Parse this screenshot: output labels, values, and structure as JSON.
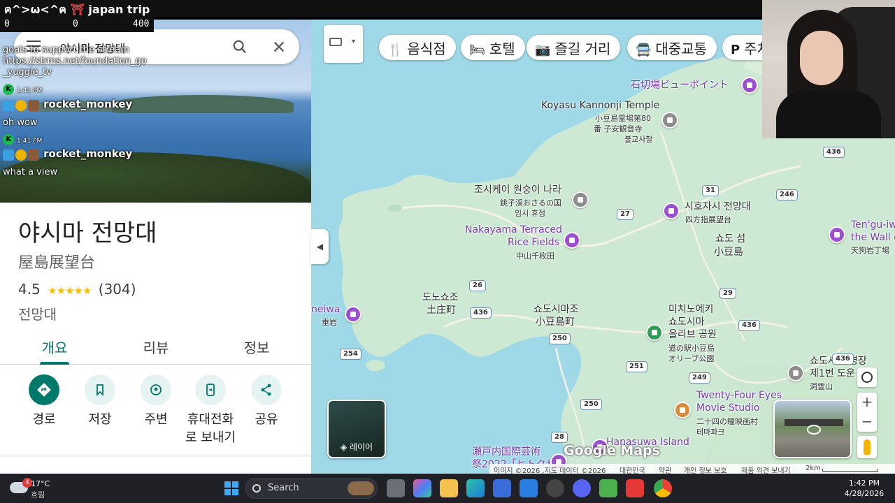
{
  "stream": {
    "title_prefix": "ฅ^>ω<^ฅ",
    "title_icon": "⛩",
    "title_text": "japan trip",
    "counter": [
      "0",
      "0",
      "400"
    ]
  },
  "chat": {
    "line1": "goals to support the stream",
    "line2": "https://strms.net/foundation_go",
    "line3": "_yuggie_tv",
    "messages": [
      {
        "time": "1:41 PM",
        "user": "rocket_monkey",
        "text": "oh wow"
      },
      {
        "time": "1:41 PM",
        "user": "rocket_monkey",
        "text": "what a view"
      }
    ]
  },
  "search": {
    "query": "야시마 전망대"
  },
  "place": {
    "name": "야시마 전망대",
    "subtitle": "屋島展望台",
    "rating": "4.5",
    "stars": "★★★★★",
    "reviews": "(304)",
    "category": "전망대"
  },
  "tabs": [
    {
      "label": "개요"
    },
    {
      "label": "리뷰"
    },
    {
      "label": "정보"
    }
  ],
  "actions": [
    {
      "label": "경로",
      "icon": "directions-icon"
    },
    {
      "label": "저장",
      "icon": "bookmark-icon"
    },
    {
      "label": "주변",
      "icon": "nearby-icon"
    },
    {
      "label": "휴대전화\n로 보내기",
      "label_l1": "휴대전화",
      "label_l2": "로 보내기",
      "icon": "send-to-phone-icon"
    },
    {
      "label": "공유",
      "icon": "share-icon"
    }
  ],
  "map": {
    "chips": [
      {
        "icon": "utensils-icon",
        "glyph": "🍴",
        "label": "음식점"
      },
      {
        "icon": "bed-icon",
        "glyph": "🛏",
        "label": "호텔"
      },
      {
        "icon": "camera-icon",
        "glyph": "📷",
        "label": "즐길 거리"
      },
      {
        "icon": "transit-icon",
        "glyph": "🚍",
        "label": "대중교통"
      },
      {
        "icon": "parking-icon",
        "glyph": "P",
        "label": "주차"
      }
    ],
    "labels": {
      "ishikiriba": "石切場ビューポイント",
      "koyasu_en": "Koyasu Kannonji Temple",
      "koyasu_jp1": "小豆島霊場第80",
      "koyasu_jp2": "番 子安観音寺",
      "koyasu_jp3": "불교사찰",
      "choshikei_ko": "조시케이 원숭이 나라",
      "choshikei_jp": "銚子渓おさるの国",
      "choshikei_status": "임시 휴점",
      "nakayama_1": "Nakayama Terraced",
      "nakayama_2": "Rice Fields",
      "nakayama_jp": "中山千枚田",
      "shihozashi_ko": "시호자시 전망대",
      "shihozashi_jp": "四方指展望台",
      "shodoshima_ko": "쇼도 섬",
      "shodoshima_jp": "小豆島",
      "tengu_1": "Ten'gu-iw",
      "tengu_2": "the Wall o",
      "tengu_3": "天狗岩丁場",
      "tonosho_ko": "도노쇼조",
      "tonosho_jp": "土庄町",
      "shodoshimacho_ko": "쇼도시마조",
      "shodoshimacho_jp": "小豆島町",
      "neiwa": "neiwa",
      "neiwa_jp": "重岩",
      "michinoeki_1": "미치노에키",
      "michinoeki_2": "쇼도시마",
      "michinoeki_3": "올리브 공원",
      "michinoeki_4": "道の駅小豆島",
      "michinoeki_5": "オリーブ公園",
      "dounzan_1": "쇼도시마 영장",
      "dounzan_2": "제1번 도운",
      "dounzan_3": "洞雲山",
      "twentyfour_1": "Twenty-Four Eyes",
      "twentyfour_2": "Movie Studio",
      "twentyfour_3": "二十四の瞳映画村",
      "twentyfour_4": "테마파크",
      "hanasuwa": "Hanasuwa Island",
      "setouchi_1": "瀬戸内国際芸術",
      "setouchi_2": "祭2022「ヒトクサ"
    },
    "roads": [
      "436",
      "31",
      "246",
      "27",
      "26",
      "436",
      "29",
      "436",
      "250",
      "254",
      "251",
      "249",
      "250",
      "436",
      "28"
    ],
    "layer_label": "레이어",
    "google_logo": "Google Maps",
    "footer": [
      "이미지 ©2026 ,지도 데이터 ©2026",
      "대한민국",
      "약관",
      "개인 정보 보호",
      "제품 의견 보내기",
      "2km"
    ]
  },
  "taskbar": {
    "weather_temp": "17°C",
    "weather_cond": "흐림",
    "weather_badge": "4",
    "search_label": "Search",
    "time": "1:42 PM",
    "date": "4/28/2026"
  }
}
